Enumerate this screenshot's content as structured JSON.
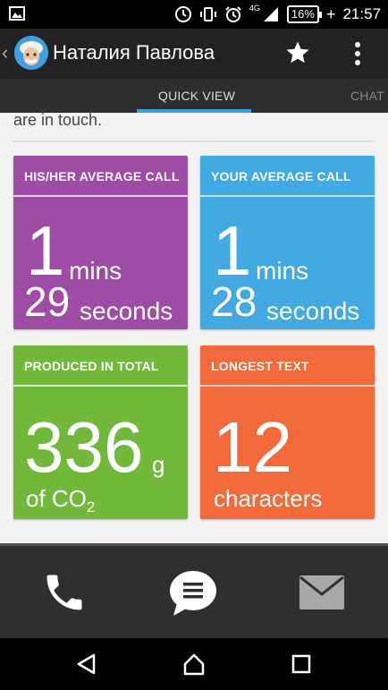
{
  "status_bar": {
    "network_label": "4G",
    "battery": "16%",
    "time": "21:57"
  },
  "app_bar": {
    "title": "Наталия Павлова"
  },
  "tabs": [
    {
      "label": "QUICK VIEW",
      "active": true
    },
    {
      "label": "CHAT",
      "active": false
    }
  ],
  "content": {
    "partial_text": "are in touch."
  },
  "cards": {
    "his_avg": {
      "title": "HIS/HER AVERAGE CALL",
      "minutes": "1",
      "minutes_unit": "mins",
      "seconds": "29",
      "seconds_unit": "seconds",
      "color": "#9e4ca6"
    },
    "your_avg": {
      "title": "YOUR AVERAGE CALL",
      "minutes": "1",
      "minutes_unit": "mins",
      "seconds": "28",
      "seconds_unit": "seconds",
      "color": "#42a9e3"
    },
    "produced": {
      "title": "PRODUCED IN TOTAL",
      "value": "336",
      "unit": "g",
      "label_prefix": "of CO",
      "label_sub": "2",
      "color": "#72b83a"
    },
    "longest": {
      "title": "LONGEST TEXT",
      "value": "12",
      "label": "characters",
      "color": "#f26a3a"
    }
  },
  "action_bar": {
    "icons": [
      "phone-icon",
      "chat-bubble-icon",
      "mail-icon"
    ]
  },
  "nav_bar": {
    "icons": [
      "back-triangle-icon",
      "home-icon",
      "recents-icon"
    ]
  }
}
